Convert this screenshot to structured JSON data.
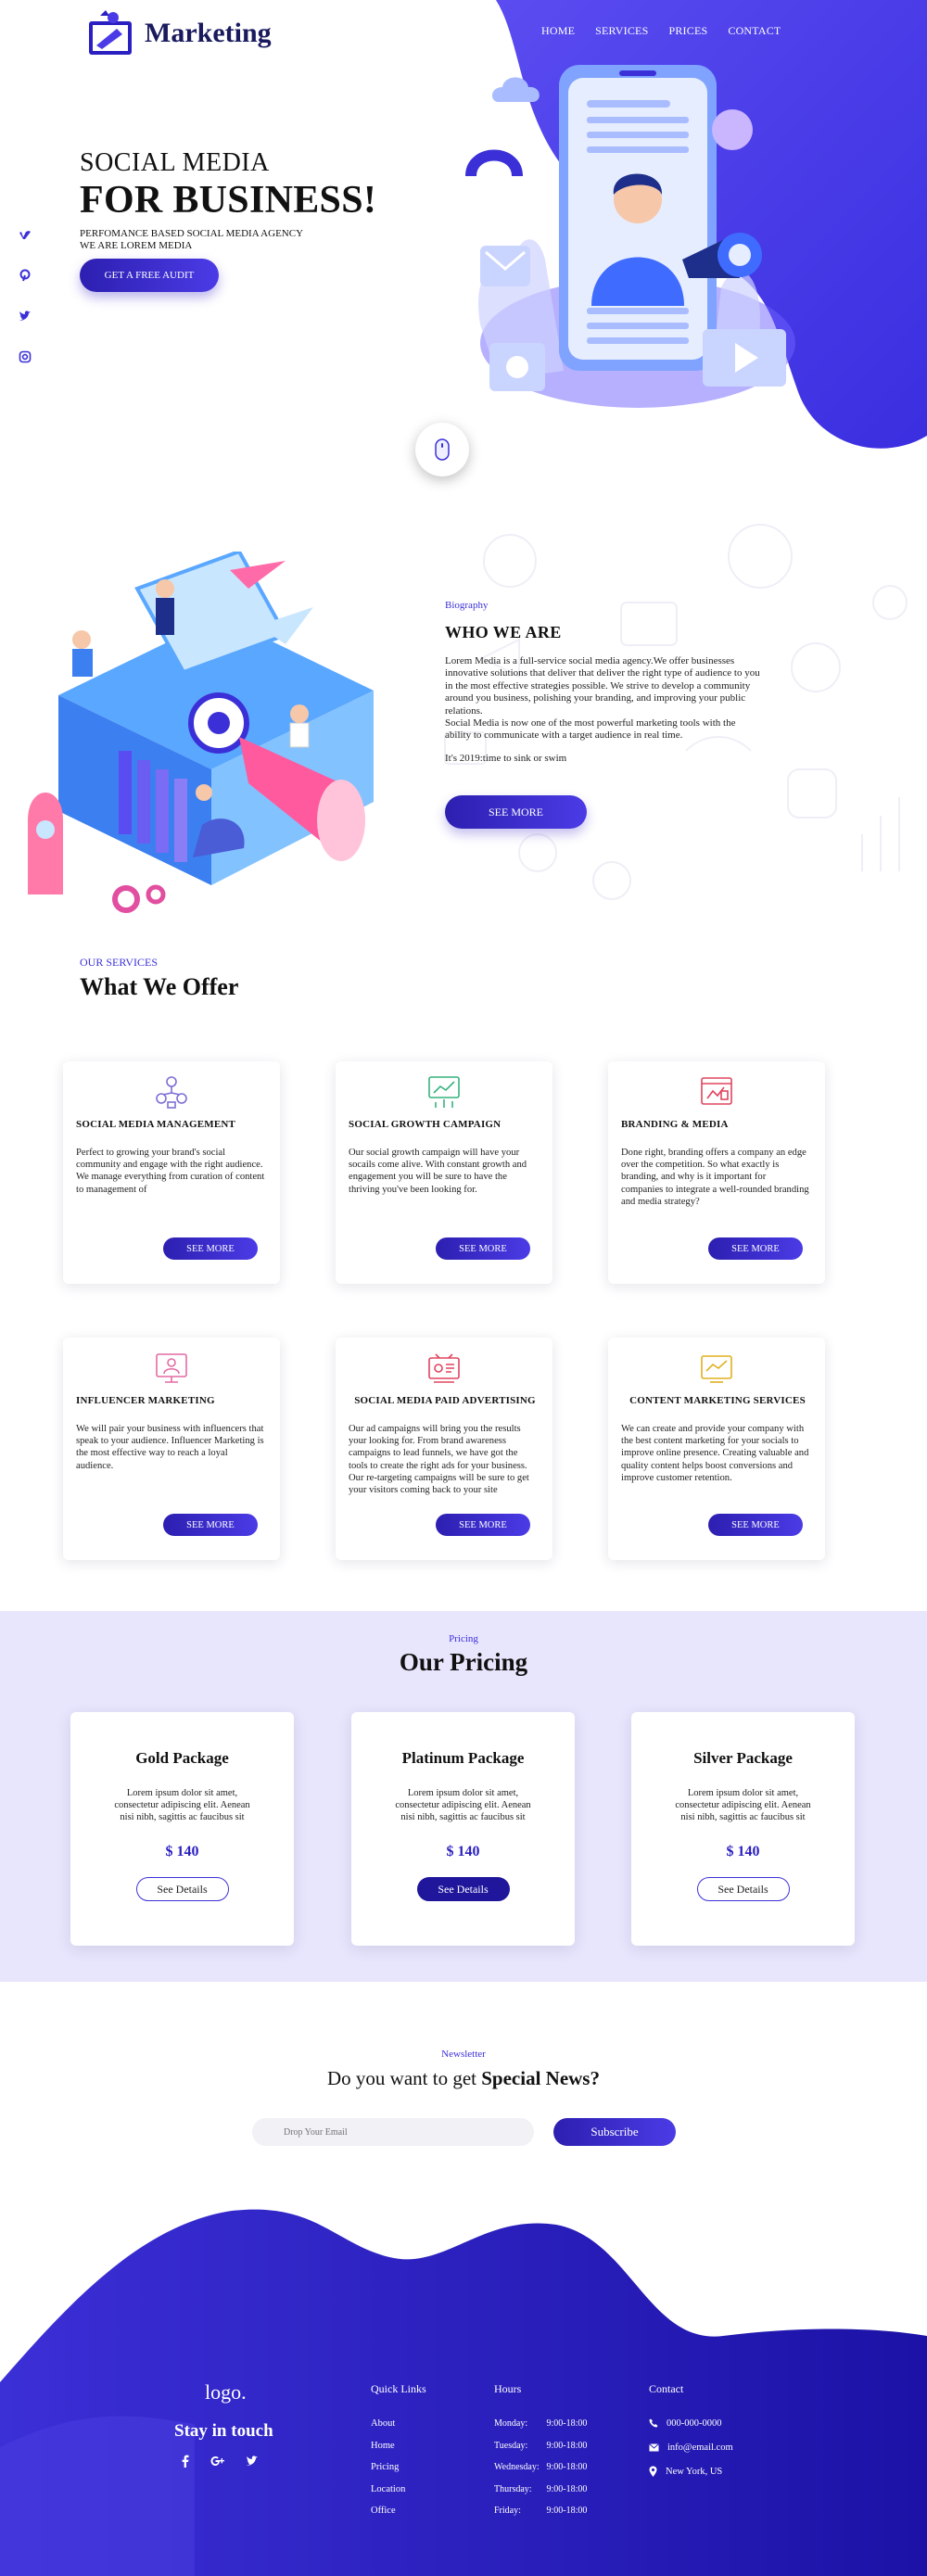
{
  "brand": {
    "name": "Marketing",
    "accent": "#3b30d8",
    "accent_dark": "#1f169c",
    "bg_tint": "#e8e6fd"
  },
  "nav": [
    "HOME",
    "SERVICES",
    "PRICES",
    "CONTACT"
  ],
  "hero": {
    "subtitle": "SOCIAL MEDIA",
    "title": "FOR BUSINESS!",
    "tagline_1": "PERFOMANCE BASED SOCIAL MEDIA AGENCY",
    "tagline_2": "WE ARE LOREM MEDIA",
    "cta": "GET A FREE AUDIT",
    "side_social_icons": [
      "vimeo-icon",
      "pinterest-icon",
      "twitter-icon",
      "instagram-icon"
    ]
  },
  "about": {
    "label": "Biography",
    "title": "WHO WE ARE",
    "p1": "Lorem Media is a full-service social media agency.We offer businesses innovative solutions that deliver that deliver the right type of audience to you in the most effective strategies possible. We strive to develop a community around you business, polishing your branding, and improving your public relations.",
    "p1b": "Social Media is now one of the most powerful marketing tools with the ability to communicate with a target audience in real time.",
    "p2": "It's 2019:time to sink or swim",
    "cta": "SEE MORE"
  },
  "services": {
    "label": "OUR SERVICES",
    "title": "What We Offer",
    "items": [
      {
        "title": "SOCIAL MEDIA MANAGEMENT",
        "text": "Perfect to growing your brand's social community and engage with the right audience. We manage everything from curation of content to management of",
        "button": "SEE MORE",
        "icon": "team-icon",
        "color": "#7b6fd6"
      },
      {
        "title": "SOCIAL GROWTH CAMPAIGN",
        "text": "Our social growth campaign will have your socails come alive. With constant growth and engagement you will be sure to have the thriving you've been looking for.",
        "button": "SEE MORE",
        "icon": "growth-icon",
        "color": "#37b37e"
      },
      {
        "title": "BRANDING & MEDIA",
        "text": "Done right, branding offers a company an edge over the competition. So what exactly is branding, and why is it important for companies to integrate a well-rounded branding and media strategy?",
        "button": "SEE MORE",
        "icon": "branding-icon",
        "color": "#e0455f"
      },
      {
        "title": "INFLUENCER MARKETING",
        "text": "We will pair your business with influencers that speak to your audience. Influencer Marketing is the most effective way to reach a loyal audience.",
        "button": "SEE MORE",
        "icon": "influencer-icon",
        "color": "#e46aa3"
      },
      {
        "title": "SOCIAL MEDIA PAID ADVERTISING",
        "text": "Our ad campaigns will bring you the results your looking for. From brand awareness campaigns to lead funnels, we have got the tools to create the right ads for your business. Our re-targeting campaigns will be sure to get your visitors coming back to your site",
        "button": "SEE MORE",
        "icon": "advertising-icon",
        "color": "#e0455f"
      },
      {
        "title": "CONTENT MARKETING SERVICES",
        "text": "We can create and provide your company with the best content marketing for your socials to improve online presence. Creating valuable and quality content helps boost conversions and improve customer retention.",
        "button": "SEE MORE",
        "icon": "content-icon",
        "color": "#e0b020"
      }
    ]
  },
  "pricing": {
    "label": "Pricing",
    "title": "Our Pricing",
    "plans": [
      {
        "name": "Gold Package",
        "text": "Lorem ipsum dolor sit amet, consectetur adipiscing elit. Aenean nisi nibh, sagittis ac faucibus sit",
        "price": "$ 140",
        "button": "See Details"
      },
      {
        "name": "Platinum Package",
        "text": "Lorem ipsum dolor sit amet, consectetur adipiscing elit. Aenean nisi nibh, sagittis ac faucibus sit",
        "price": "$ 140",
        "button": "See Details"
      },
      {
        "name": "Silver Package",
        "text": "Lorem ipsum dolor sit amet, consectetur adipiscing elit. Aenean nisi nibh, sagittis ac faucibus sit",
        "price": "$ 140",
        "button": "See Details"
      }
    ]
  },
  "newsletter": {
    "label": "Newsletter",
    "title_plain": "Do you want to get ",
    "title_bold": "Special News?",
    "placeholder": "Drop Your Email",
    "button": "Subscribe"
  },
  "footer": {
    "logo": "logo.",
    "stay": "Stay in touch",
    "social_icons": [
      "facebook-icon",
      "google-plus-icon",
      "twitter-icon"
    ],
    "quick_links_title": "Quick Links",
    "quick_links": [
      "About",
      "Home",
      "Pricing",
      "Location",
      "Office"
    ],
    "hours_title": "Hours",
    "hours": [
      {
        "day": "Monday:",
        "time": "9:00-18:00"
      },
      {
        "day": "Tuesday:",
        "time": "9:00-18:00"
      },
      {
        "day": "Wednesday:",
        "time": "9:00-18:00"
      },
      {
        "day": "Thursday:",
        "time": "9:00-18:00"
      },
      {
        "day": "Friday:",
        "time": "9:00-18:00"
      }
    ],
    "contact_title": "Contact",
    "contact": [
      {
        "icon": "phone-icon",
        "text": "000-000-0000"
      },
      {
        "icon": "mail-icon",
        "text": "info@email.com"
      },
      {
        "icon": "location-icon",
        "text": "New York, US"
      }
    ]
  }
}
